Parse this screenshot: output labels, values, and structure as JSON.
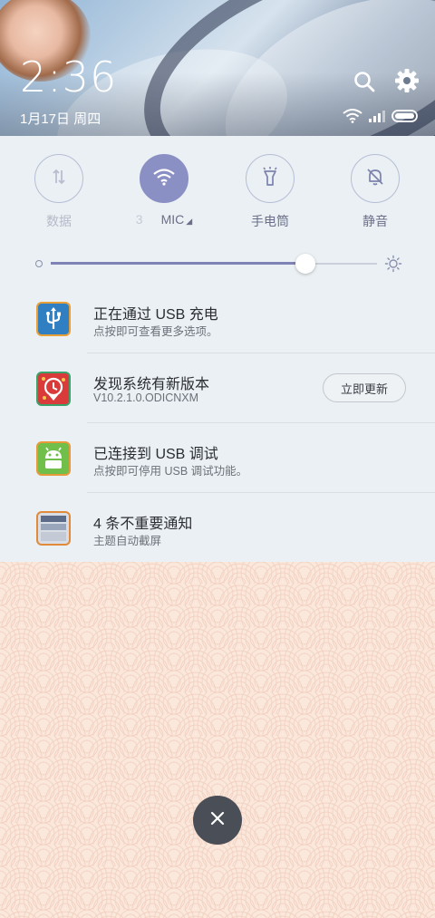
{
  "header": {
    "time": "2:36",
    "date": "1月17日 周四"
  },
  "toggles": [
    {
      "label": "数据",
      "state": "off",
      "icon": "data-transfer-icon"
    },
    {
      "label_prefix": "3",
      "label": "MIC",
      "state": "on",
      "icon": "wifi-icon"
    },
    {
      "label": "手电筒",
      "state": "off",
      "icon": "flashlight-icon"
    },
    {
      "label": "静音",
      "state": "off",
      "icon": "bell-off-icon"
    }
  ],
  "brightness": {
    "level": 0.78
  },
  "notifications": [
    {
      "title": "正在通过 USB 充电",
      "subtitle": "点按即可查看更多选项。",
      "icon": "usb-icon"
    },
    {
      "title": "发现系统有新版本",
      "subtitle": "V10.2.1.0.ODICNXM",
      "icon": "update-icon",
      "action": "立即更新"
    },
    {
      "title": "已连接到 USB 调试",
      "subtitle": "点按即可停用 USB 调试功能。",
      "icon": "android-icon"
    },
    {
      "title": "4 条不重要通知",
      "subtitle": "主题自动截屏",
      "icon": "screenshot-icon"
    }
  ],
  "colors": {
    "accent": "#8a8fc4",
    "panel_bg": "#eaf0f3",
    "lower_bg": "#fbe8dc"
  }
}
